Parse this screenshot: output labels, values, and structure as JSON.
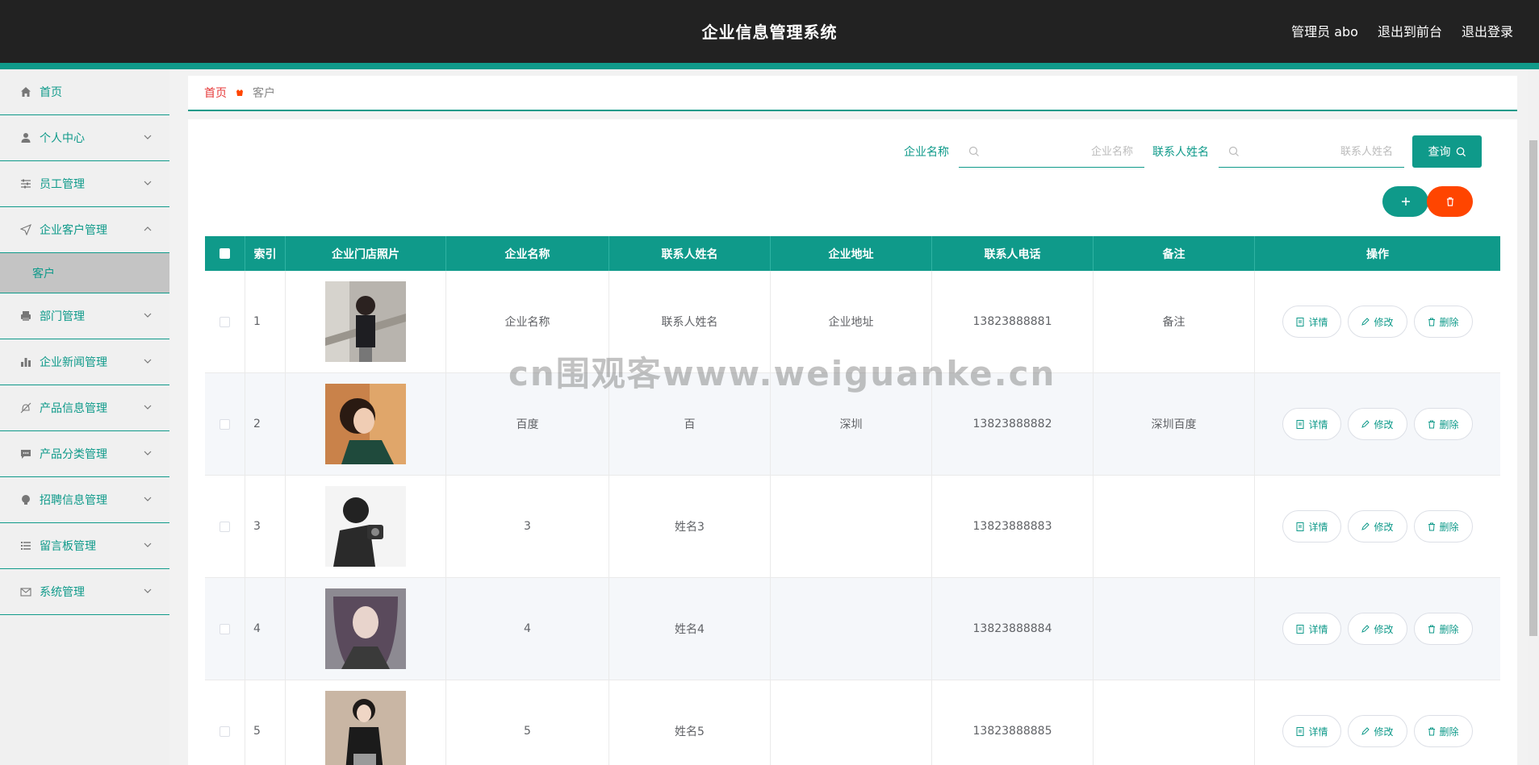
{
  "header": {
    "title": "企业信息管理系统",
    "admin_label": "管理员 abo",
    "to_front_label": "退出到前台",
    "logout_label": "退出登录"
  },
  "sidebar": {
    "items": [
      {
        "label": "首页",
        "icon": "home-icon"
      },
      {
        "label": "个人中心",
        "icon": "user-icon"
      },
      {
        "label": "员工管理",
        "icon": "sliders-icon"
      },
      {
        "label": "企业客户管理",
        "icon": "send-icon"
      },
      {
        "label": "部门管理",
        "icon": "printer-icon"
      },
      {
        "label": "企业新闻管理",
        "icon": "bar-chart-icon"
      },
      {
        "label": "产品信息管理",
        "icon": "bell-off-icon"
      },
      {
        "label": "产品分类管理",
        "icon": "chat-icon"
      },
      {
        "label": "招聘信息管理",
        "icon": "bulb-icon"
      },
      {
        "label": "留言板管理",
        "icon": "list-icon"
      },
      {
        "label": "系统管理",
        "icon": "mail-icon"
      }
    ],
    "active_sub": "客户"
  },
  "breadcrumb": {
    "home": "首页",
    "current": "客户"
  },
  "search": {
    "company_label": "企业名称",
    "company_placeholder": "企业名称",
    "contact_label": "联系人姓名",
    "contact_placeholder": "联系人姓名",
    "query_label": "查询"
  },
  "table": {
    "headers": [
      "索引",
      "企业门店照片",
      "企业名称",
      "联系人姓名",
      "企业地址",
      "联系人电话",
      "备注",
      "操作"
    ],
    "rows": [
      {
        "index": "1",
        "company": "企业名称",
        "contact": "联系人姓名",
        "address": "企业地址",
        "phone": "13823888881",
        "remark": "备注"
      },
      {
        "index": "2",
        "company": "百度",
        "contact": "百",
        "address": "深圳",
        "phone": "13823888882",
        "remark": "深圳百度"
      },
      {
        "index": "3",
        "company": "3",
        "contact": "姓名3",
        "address": "",
        "phone": "13823888883",
        "remark": ""
      },
      {
        "index": "4",
        "company": "4",
        "contact": "姓名4",
        "address": "",
        "phone": "13823888884",
        "remark": ""
      },
      {
        "index": "5",
        "company": "5",
        "contact": "姓名5",
        "address": "",
        "phone": "13823888885",
        "remark": ""
      }
    ],
    "actions": {
      "detail": "详情",
      "edit": "修改",
      "delete": "删除"
    }
  },
  "watermark": "cn围观客www.weiguanke.cn",
  "colors": {
    "accent": "#0f9a8a",
    "danger": "#ff4500",
    "header_bg": "#222222"
  }
}
